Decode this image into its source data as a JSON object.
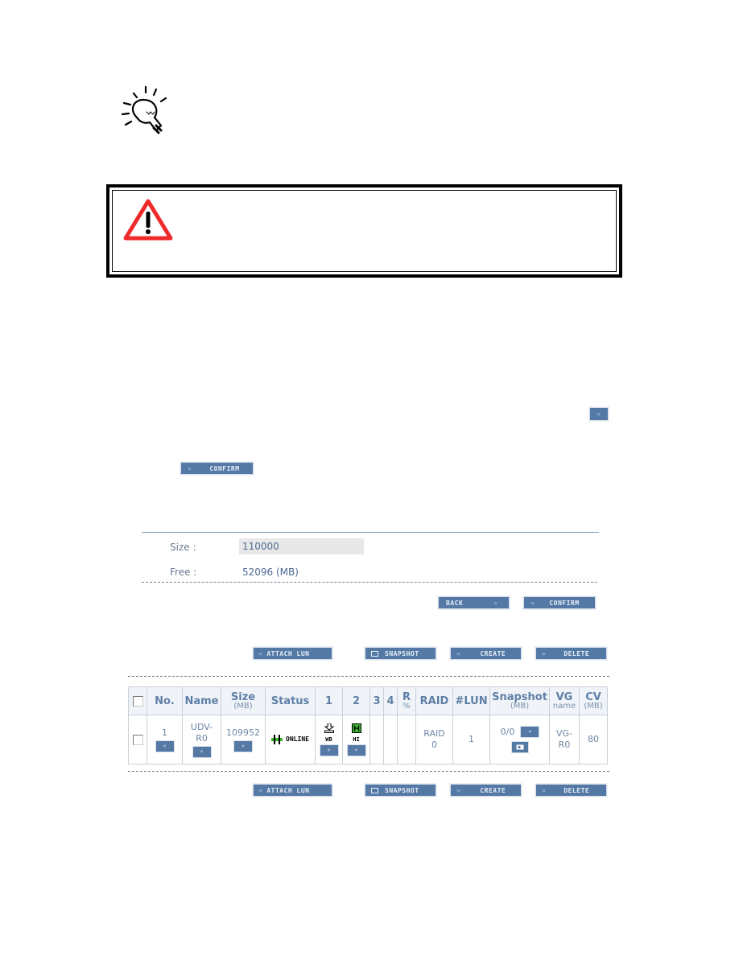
{
  "tip": {
    "icon": "lightbulb-icon"
  },
  "warning": {
    "icon": "warning-triangle-icon"
  },
  "inline_buttons": {
    "back_small": {
      "chevron": "«"
    },
    "confirm": {
      "chevron": "»",
      "label": "CONFIRM"
    }
  },
  "form": {
    "size_label": "Size :",
    "size_value": "110000",
    "free_label": "Free :",
    "free_value": "52096 (MB)",
    "back_button": {
      "label": "BACK",
      "chevron": "«"
    },
    "confirm_button": {
      "chevron": "»",
      "label": "CONFIRM"
    }
  },
  "toolbar": {
    "attach_lun": {
      "chevron": "»",
      "label": "ATTACH LUN"
    },
    "snapshot": {
      "icon": "snapshot-icon",
      "label": "SNAPSHOT"
    },
    "create": {
      "chevron": "»",
      "label": "CREATE"
    },
    "delete": {
      "chevron": "»",
      "label": "DELETE"
    }
  },
  "table": {
    "headers": [
      {
        "label": "",
        "sub": ""
      },
      {
        "label": "No.",
        "sub": ""
      },
      {
        "label": "Name",
        "sub": ""
      },
      {
        "label": "Size",
        "sub": "(MB)"
      },
      {
        "label": "Status",
        "sub": ""
      },
      {
        "label": "1",
        "sub": ""
      },
      {
        "label": "2",
        "sub": ""
      },
      {
        "label": "3",
        "sub": ""
      },
      {
        "label": "4",
        "sub": ""
      },
      {
        "label": "R",
        "sub": "%"
      },
      {
        "label": "RAID",
        "sub": ""
      },
      {
        "label": "#LUN",
        "sub": ""
      },
      {
        "label": "Snapshot",
        "sub": "(MB)"
      },
      {
        "label": "VG",
        "sub": "name"
      },
      {
        "label": "CV",
        "sub": "(MB)"
      }
    ],
    "rows": [
      {
        "no": "1",
        "name_line1": "UDV-",
        "name_line2": "R0",
        "size": "109952",
        "status": "ONLINE",
        "col1_label": "WB",
        "col2_label": "HI",
        "col3": "",
        "col4": "",
        "r_pct": "",
        "raid_line1": "RAID",
        "raid_line2": "0",
        "lun_count": "1",
        "snapshot": "0/0",
        "vg_line1": "VG-",
        "vg_line2": "R0",
        "cv": "80",
        "cell_button": "«"
      }
    ]
  },
  "colors": {
    "button_bg": "#5579a5",
    "button_text": "#e6eef8",
    "header_text": "#5f7fa8",
    "warning_red": "#ee2a2a",
    "status_green": "#3cba2e"
  }
}
